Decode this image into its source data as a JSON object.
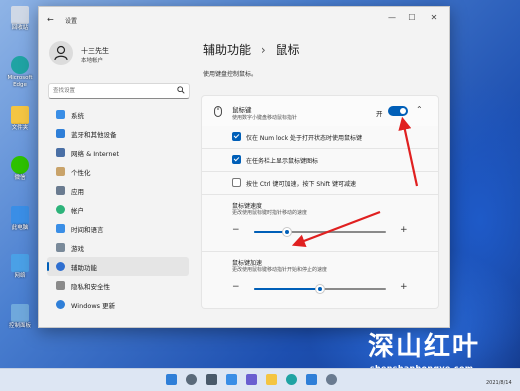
{
  "desktop": {
    "icons": [
      {
        "label": "回收站",
        "icon": "recycle-bin-icon",
        "color": "#cfd8e6"
      },
      {
        "label": "Microsoft Edge",
        "icon": "edge-icon",
        "color": "#1fa3a3"
      },
      {
        "label": "文件夹",
        "icon": "folder-icon",
        "color": "#f4c542"
      },
      {
        "label": "微信",
        "icon": "wechat-icon",
        "color": "#2dc100"
      },
      {
        "label": "此电脑",
        "icon": "computer-icon",
        "color": "#3a8ee6"
      },
      {
        "label": "网络",
        "icon": "network-icon",
        "color": "#4aa0e6"
      },
      {
        "label": "控制面板",
        "icon": "control-panel-icon",
        "color": "#6fa8dc"
      }
    ]
  },
  "window": {
    "title": "设置",
    "controls": {
      "minimize": "—",
      "maximize": "☐",
      "close": "✕"
    }
  },
  "profile": {
    "name": "十三先生",
    "subtitle": "本地帐户"
  },
  "search": {
    "placeholder": "查找设置"
  },
  "nav": {
    "items": [
      {
        "label": "系统",
        "icon": "system-icon",
        "color": "#3a8ee6",
        "active": false
      },
      {
        "label": "蓝牙和其他设备",
        "icon": "bluetooth-icon",
        "color": "#2f7fd8",
        "active": false
      },
      {
        "label": "网络 & Internet",
        "icon": "network-icon",
        "color": "#4a6fa5",
        "active": false
      },
      {
        "label": "个性化",
        "icon": "personalization-icon",
        "color": "#c9a36a",
        "active": false
      },
      {
        "label": "应用",
        "icon": "apps-icon",
        "color": "#6a7b90",
        "active": false
      },
      {
        "label": "帐户",
        "icon": "accounts-icon",
        "color": "#2db37a",
        "active": false
      },
      {
        "label": "时间和语言",
        "icon": "time-language-icon",
        "color": "#3a8ee6",
        "active": false
      },
      {
        "label": "游戏",
        "icon": "gaming-icon",
        "color": "#7a8a9a",
        "active": false
      },
      {
        "label": "辅助功能",
        "icon": "accessibility-icon",
        "color": "#2f6fd0",
        "active": true
      },
      {
        "label": "隐私和安全性",
        "icon": "privacy-icon",
        "color": "#8a8a8a",
        "active": false
      },
      {
        "label": "Windows 更新",
        "icon": "windows-update-icon",
        "color": "#2f7fd8",
        "active": false
      }
    ]
  },
  "main": {
    "breadcrumb_parent": "辅助功能",
    "breadcrumb_sep": "›",
    "breadcrumb_current": "鼠标",
    "description": "使用键盘控制鼠标。",
    "mouse_keys": {
      "title": "鼠标键",
      "subtitle": "使用数字小键盘移动鼠标指针",
      "toggle_label": "开",
      "toggle_on": true
    },
    "options": [
      {
        "label": "仅在 Num lock 处于打开状态时使用鼠标键",
        "checked": true
      },
      {
        "label": "在任务栏上显示鼠标键图标",
        "checked": true
      },
      {
        "label": "按住 Ctrl 键可加速，按下 Shift 键可减速",
        "checked": false
      }
    ],
    "sliders": [
      {
        "title": "鼠标键速度",
        "subtitle": "更改使用鼠标键时指针移动的速度",
        "value": 0.25
      },
      {
        "title": "鼠标键加速",
        "subtitle": "更改使用鼠标键移动指针开始和停止的速度",
        "value": 0.5
      }
    ]
  },
  "watermark": {
    "title": "深山红叶",
    "url": "shenshanhongye.com"
  },
  "taskbar": {
    "icons": [
      {
        "icon": "start-icon",
        "color": "#2f7fd8"
      },
      {
        "icon": "search-icon",
        "color": "#5a6a7a"
      },
      {
        "icon": "task-view-icon",
        "color": "#4a5a6a"
      },
      {
        "icon": "widgets-icon",
        "color": "#3a8ee6"
      },
      {
        "icon": "chat-icon",
        "color": "#6a5fd0"
      },
      {
        "icon": "file-explorer-icon",
        "color": "#f4c542"
      },
      {
        "icon": "edge-icon",
        "color": "#1fa3a3"
      },
      {
        "icon": "store-icon",
        "color": "#2f7fd8"
      },
      {
        "icon": "settings-icon",
        "color": "#6a7b90"
      }
    ],
    "date": "2021/8/14"
  }
}
